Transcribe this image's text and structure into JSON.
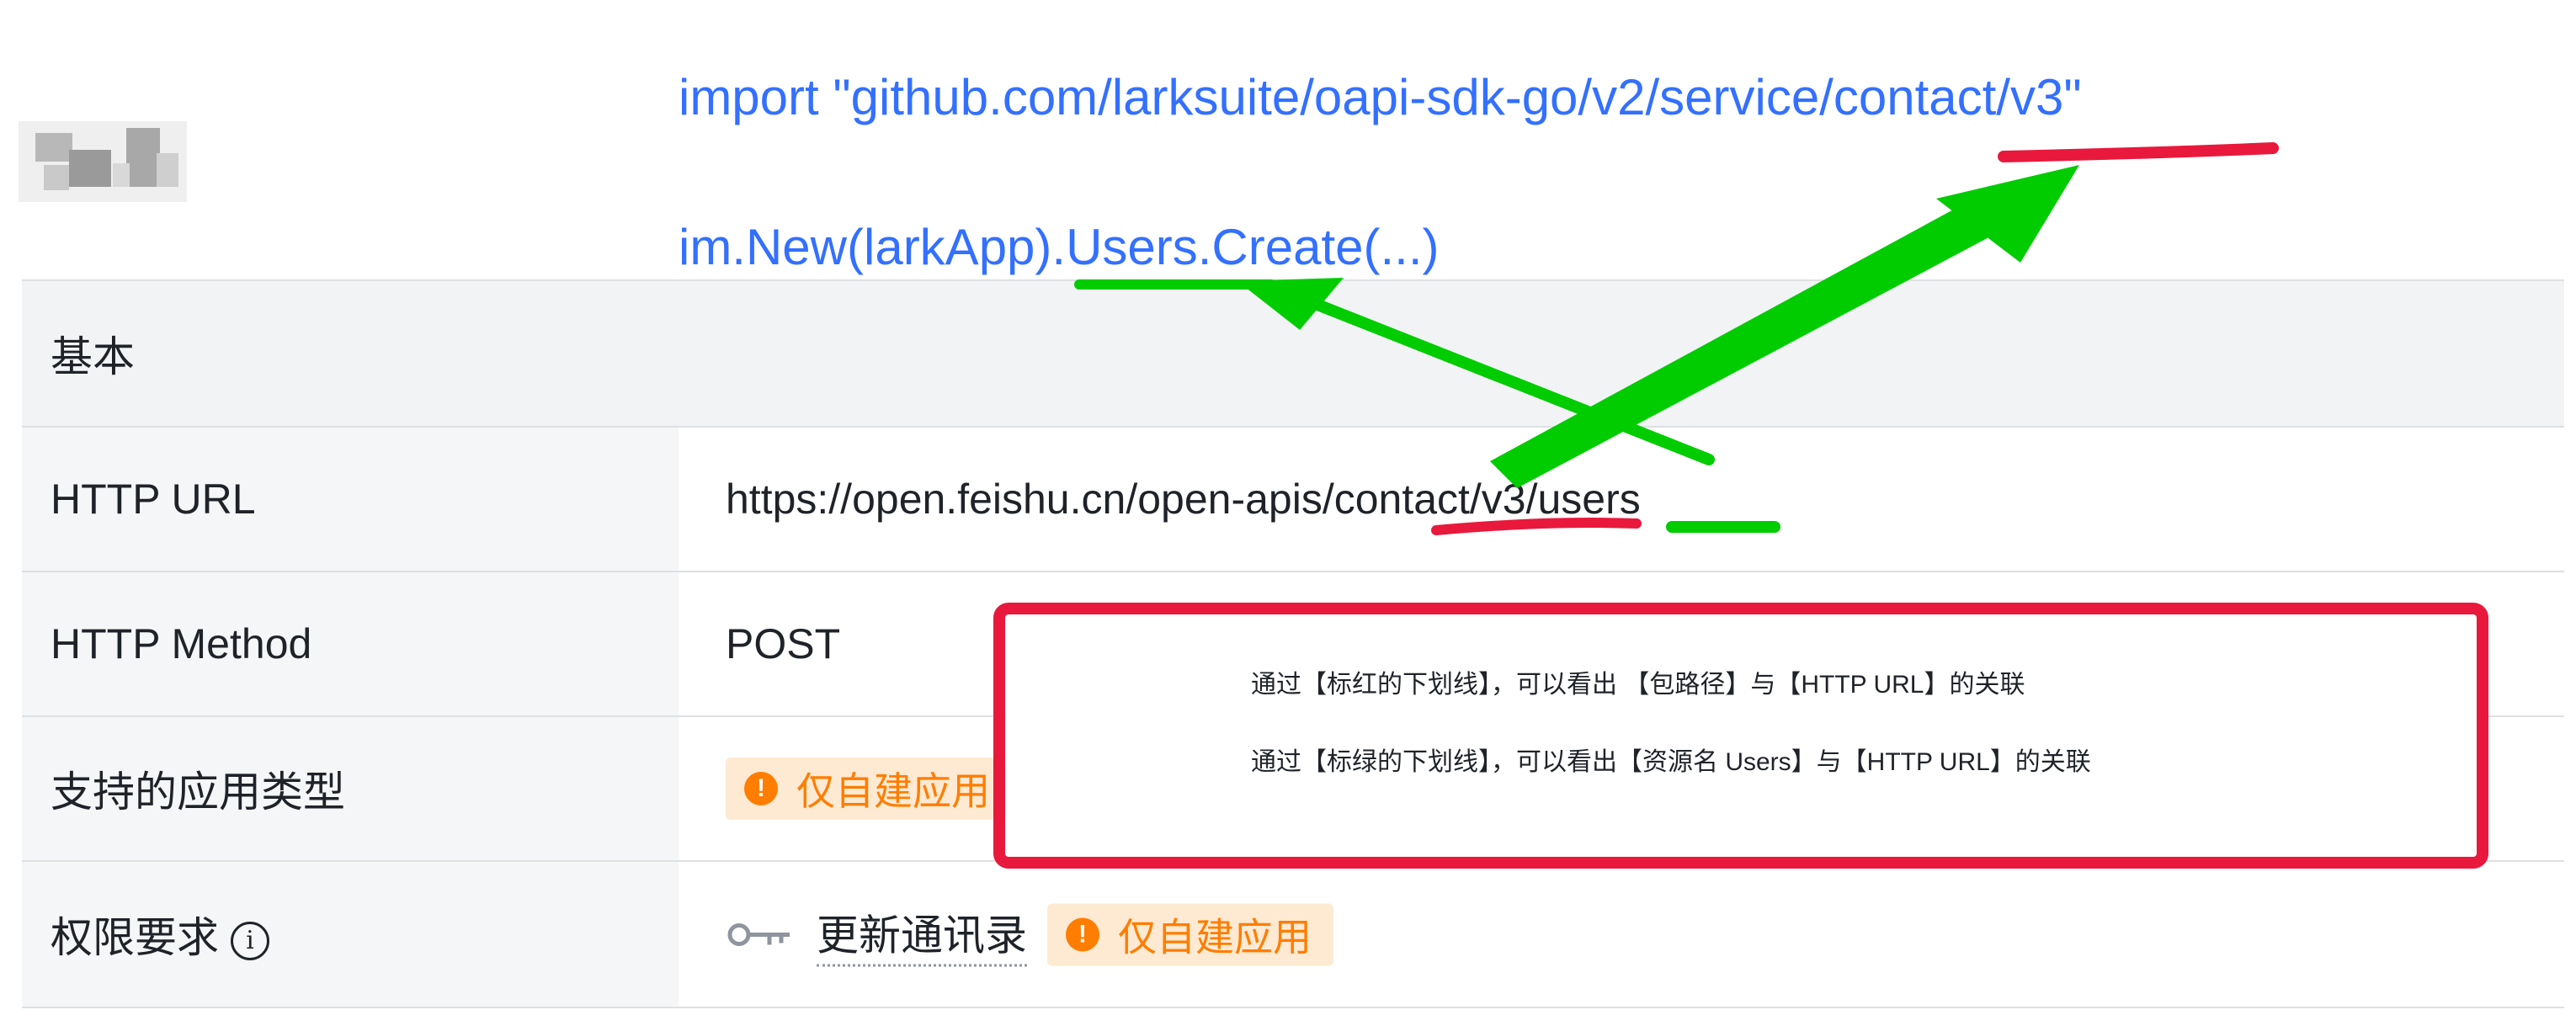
{
  "code": {
    "import_line": "import \"github.com/larksuite/oapi-sdk-go/v2/service/contact/v3\"",
    "call_line": "im.New(larkApp).Users.Create(...)"
  },
  "table": {
    "header": "基本",
    "rows": [
      {
        "label": "HTTP URL",
        "value": "https://open.feishu.cn/open-apis/contact/v3/users"
      },
      {
        "label": "HTTP Method",
        "value": "POST"
      },
      {
        "label": "支持的应用类型",
        "tag": "仅自建应用"
      },
      {
        "label": "权限要求",
        "permission": "更新通讯录",
        "tag": "仅自建应用"
      }
    ]
  },
  "annotation": {
    "red_note": "通过【标红的下划线】，可以看出 【包路径】与【HTTP URL】的关联",
    "green_note": "通过【标绿的下划线】，可以看出【资源名 Users】与【HTTP URL】的关联"
  },
  "colors": {
    "link_blue": "#3370ff",
    "tag_orange": "#ff7d00",
    "tag_bg": "#feead2",
    "annotation_red": "#e8193c",
    "annotation_green": "#00cc00"
  },
  "icons": [
    "key-icon",
    "info-icon",
    "exclamation-icon"
  ]
}
